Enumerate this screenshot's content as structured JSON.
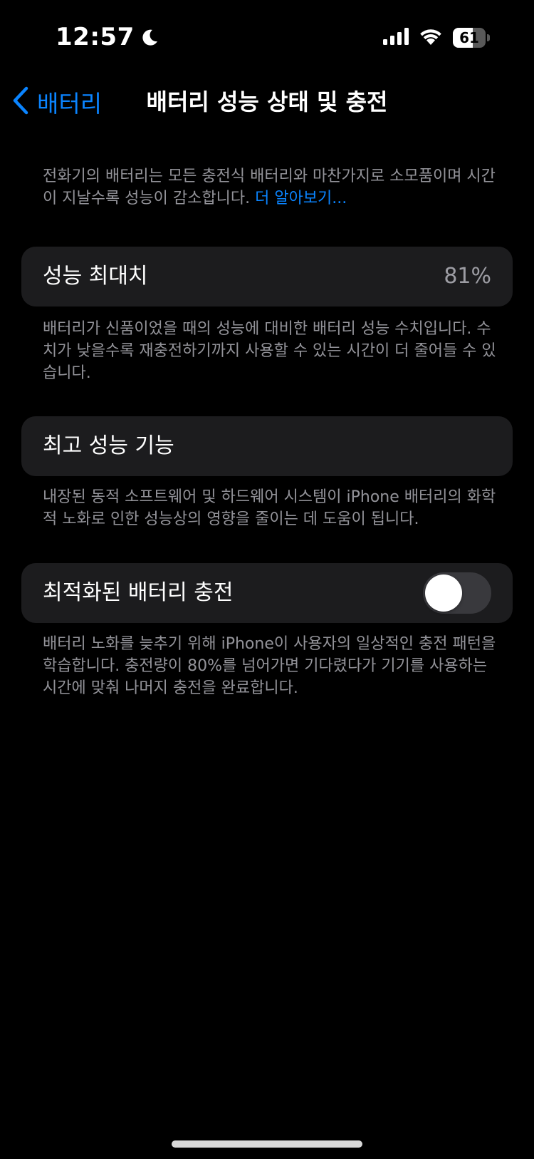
{
  "status_bar": {
    "time": "12:57",
    "battery_level": "61",
    "battery_fraction": 0.61
  },
  "nav": {
    "back_label": "배터리",
    "title": "배터리 성능 상태 및 충전"
  },
  "intro": {
    "text": "전화기의 배터리는 모든 충전식 배터리와 마찬가지로 소모품이며 시간이 지날수록 성능이 감소합니다. ",
    "link": "더 알아보기..."
  },
  "max_capacity": {
    "label": "성능 최대치",
    "value": "81%",
    "description": "배터리가 신품이었을 때의 성능에 대비한 배터리 성능 수치입니다. 수치가 낮을수록 재충전하기까지 사용할 수 있는 시간이 더 줄어들 수 있습니다."
  },
  "peak_performance": {
    "label": "최고 성능 기능",
    "description": "내장된 동적 소프트웨어 및 하드웨어 시스템이 iPhone 배터리의 화학적 노화로 인한 성능상의 영향을 줄이는 데 도움이 됩니다."
  },
  "optimized_charging": {
    "label": "최적화된 배터리 충전",
    "enabled": false,
    "description": "배터리 노화를 늦추기 위해 iPhone이 사용자의 일상적인 충전 패턴을 학습합니다. 충전량이 80%를 넘어가면 기다렸다가 기기를 사용하는 시간에 맞춰 나머지 충전을 완료합니다."
  },
  "icons": {
    "back": "chevron-left-icon",
    "moon": "moon-icon",
    "signal": "cellular-signal-icon",
    "wifi": "wifi-icon",
    "battery": "battery-icon"
  },
  "colors": {
    "accent": "#0a84ff",
    "cell_background": "#1c1c1e",
    "toggle_off": "#39393d"
  }
}
